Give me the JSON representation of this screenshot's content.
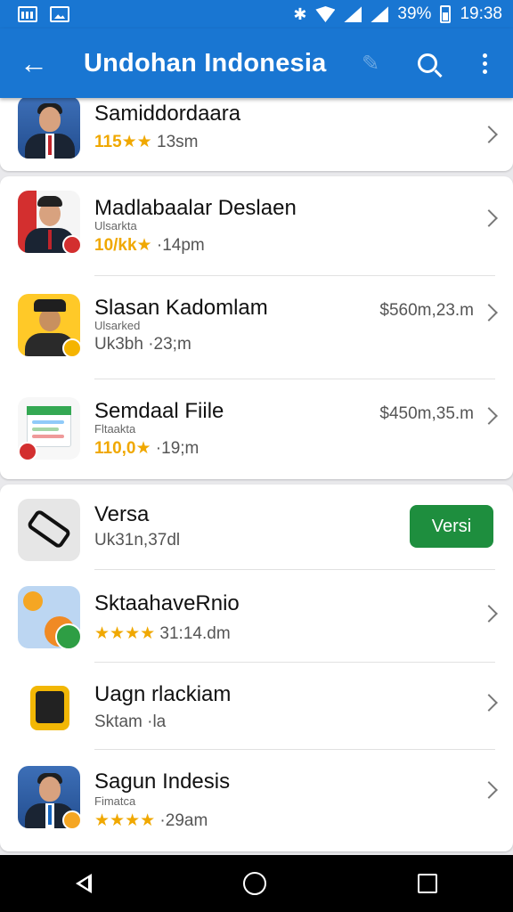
{
  "status_bar": {
    "battery": "39%",
    "time": "19:38"
  },
  "app_bar": {
    "title": "Undohan Indonesia"
  },
  "items": [
    {
      "name": "Samiddordaara",
      "sub": "",
      "stars": "115★★",
      "meta": "13sm",
      "price": "",
      "thumb": "person-blue"
    },
    {
      "name": "Madlabaalar Deslaen",
      "sub": "Ulsarkta",
      "stars": "10/kk★",
      "meta": "14pm",
      "price": "",
      "thumb": "person-flag"
    },
    {
      "name": "Slasan Kadomlam",
      "sub": "Ulsarked",
      "stars": "",
      "meta": "Uk3bh ·23;m",
      "price": "$560m,23.m",
      "thumb": "person-yellow"
    },
    {
      "name": "Semdaal Fiile",
      "sub": "Fltaakta",
      "stars": "110,0★",
      "meta": "19;m",
      "price": "$450m,35.m",
      "thumb": "spreadsheet"
    },
    {
      "name": "Versa",
      "sub": "",
      "stars": "",
      "meta": "Uk31n,37dl",
      "button": "Versi",
      "thumb": "device"
    },
    {
      "name": "SktaahaveRnio",
      "sub": "",
      "stars": "★★★★",
      "meta": "31:14.dm",
      "price": "",
      "thumb": "app-check"
    },
    {
      "name": "Uagn rlackiam",
      "sub": "",
      "stars": "",
      "meta": "Sktam ·la",
      "price": "",
      "thumb": "phone"
    },
    {
      "name": "Sagun Indesis",
      "sub": "Fimatca",
      "stars": "★★★★",
      "meta": "29am",
      "price": "",
      "thumb": "person-blue-2"
    }
  ],
  "colors": {
    "primary": "#1976d2",
    "star": "#f0a800",
    "button": "#1e8e3e"
  }
}
